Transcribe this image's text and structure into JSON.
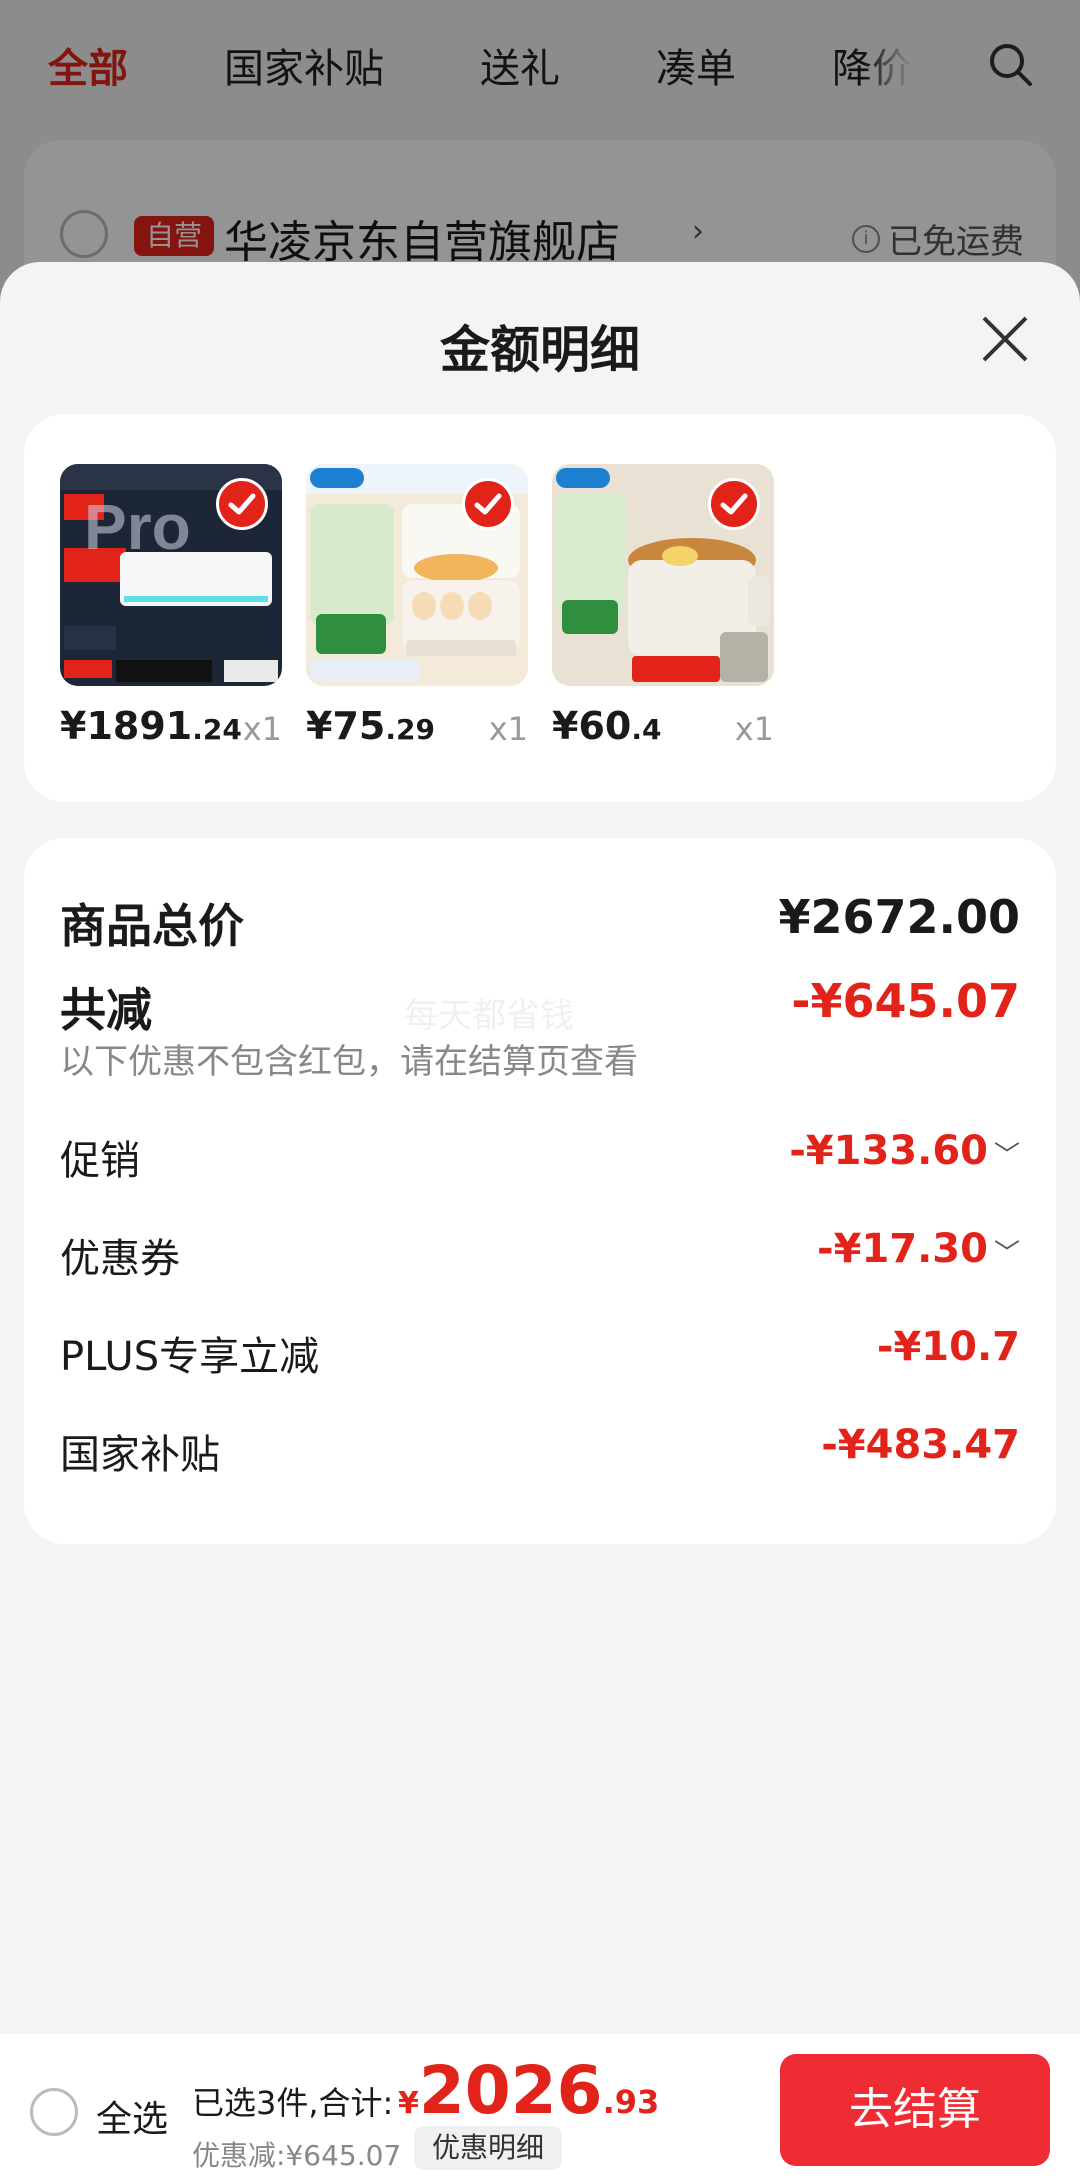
{
  "tabs": {
    "items": [
      "全部",
      "国家补贴",
      "送礼",
      "凑单",
      "降价"
    ]
  },
  "store": {
    "badge": "自营",
    "name": "华凌京东自营旗舰店",
    "chevron": "›",
    "shipping_icon": "i",
    "shipping": "已免运费"
  },
  "modal": {
    "title": "金额明细"
  },
  "products": [
    {
      "price_int": "¥1891",
      "price_dec": ".24",
      "qty": "x1",
      "image": "air-conditioner",
      "checked": true
    },
    {
      "price_int": "¥75",
      "price_dec": ".29",
      "qty": "x1",
      "image": "egg-steamer",
      "checked": true
    },
    {
      "price_int": "¥60",
      "price_dec": ".4",
      "qty": "x1",
      "image": "electric-cooker",
      "checked": true
    }
  ],
  "summary": {
    "total_label": "商品总价",
    "total_value": "¥2672.00",
    "reduce_label": "共减",
    "reduce_value": "-¥645.07",
    "note": "以下优惠不包含红包，请在结算页查看",
    "watermark": "每天都省钱",
    "rows": [
      {
        "label": "促销",
        "value": "-¥133.60",
        "caret": "﹀"
      },
      {
        "label": "优惠券",
        "value": "-¥17.30",
        "caret": "﹀"
      },
      {
        "label": "PLUS专享立减",
        "value": "-¥10.7"
      },
      {
        "label": "国家补贴",
        "value": "-¥483.47"
      }
    ]
  },
  "bottom": {
    "select_all": "全选",
    "selected_count": "已选3件,合计:",
    "currency": "¥",
    "total_int": "2026",
    "total_dec": ".93",
    "discount": "优惠减:¥645.07",
    "detail": "优惠明细",
    "checkout": "去结算"
  },
  "colors": {
    "accent": "#e2231a",
    "checkout": "#ef2b33"
  }
}
